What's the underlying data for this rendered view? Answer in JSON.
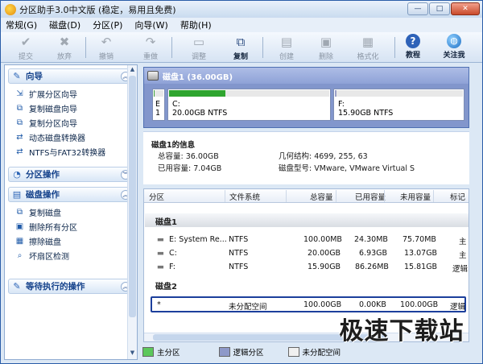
{
  "window": {
    "title": "分区助手3.0中文版 (稳定，易用且免费)",
    "buttons": {
      "minimize": "—",
      "maximize": "□",
      "close": "✕"
    }
  },
  "menu": [
    "常规(G)",
    "磁盘(D)",
    "分区(P)",
    "向导(W)",
    "帮助(H)"
  ],
  "toolbar": [
    {
      "label": "提交",
      "icon": "check-icon",
      "enabled": false
    },
    {
      "label": "放弃",
      "icon": "x-icon",
      "enabled": false
    },
    {
      "label": "撤销",
      "icon": "undo-icon",
      "enabled": false
    },
    {
      "label": "重做",
      "icon": "redo-icon",
      "enabled": false
    },
    {
      "label": "调整",
      "icon": "resize-icon",
      "enabled": false
    },
    {
      "label": "复制",
      "icon": "copy-disk-icon",
      "enabled": true
    },
    {
      "label": "创建",
      "icon": "create-icon",
      "enabled": false
    },
    {
      "label": "删除",
      "icon": "delete-icon",
      "enabled": false
    },
    {
      "label": "格式化",
      "icon": "format-icon",
      "enabled": false
    },
    {
      "label": "教程",
      "icon": "help-icon",
      "enabled": true
    },
    {
      "label": "关注我",
      "icon": "globe-icon",
      "enabled": true
    }
  ],
  "sidebar": {
    "wizard": {
      "title": "向导",
      "items": [
        "扩展分区向导",
        "复制磁盘向导",
        "复制分区向导",
        "动态磁盘转换器",
        "NTFS与FAT32转换器"
      ]
    },
    "partition_ops": {
      "title": "分区操作"
    },
    "disk_ops": {
      "title": "磁盘操作",
      "items": [
        "复制磁盘",
        "删除所有分区",
        "擦除磁盘",
        "坏扇区检测"
      ]
    },
    "pending": {
      "title": "等待执行的操作"
    }
  },
  "disk_map": {
    "title": "磁盘1 (36.00GB)",
    "partitions": [
      {
        "letter": "E",
        "sub": "1",
        "used_fraction": 0.1,
        "color": "#3da33d"
      },
      {
        "letter": "C:",
        "sub": "20.00GB NTFS",
        "used_fraction": 0.35,
        "color": "#2fa52f"
      },
      {
        "letter": "F:",
        "sub": "15.90GB NTFS",
        "used_fraction": 0.01,
        "color": "#9aa0c8"
      }
    ]
  },
  "disk_info": {
    "heading": "磁盘1的信息",
    "total_label": "总容量: 36.00GB",
    "free_label": "已用容量: 7.04GB",
    "geometry_label": "几何结构: 4699, 255, 63",
    "model_label": "磁盘型号: VMware, VMware Virtual S"
  },
  "table": {
    "columns": [
      "分区",
      "文件系统",
      "总容量",
      "已用容量",
      "未用容量",
      "标记"
    ],
    "groups": [
      {
        "name": "磁盘1",
        "rows": [
          [
            "E:  System Re...",
            "NTFS",
            "100.00MB",
            "24.30MB",
            "75.70MB",
            "主"
          ],
          [
            "C:",
            "NTFS",
            "20.00GB",
            "6.93GB",
            "13.07GB",
            "主"
          ],
          [
            "F:",
            "NTFS",
            "15.90GB",
            "86.26MB",
            "15.81GB",
            "逻辑"
          ]
        ]
      },
      {
        "name": "磁盘2",
        "rows": [
          [
            "*",
            "未分配空间",
            "100.00GB",
            "0.00KB",
            "100.00GB",
            "逻辑"
          ]
        ]
      }
    ]
  },
  "legend": [
    {
      "label": "主分区",
      "color": "#5cc85c"
    },
    {
      "label": "逻辑分区",
      "color": "#8e99c9"
    },
    {
      "label": "未分配空间",
      "color": "#f0f0f0"
    }
  ],
  "watermark": "极速下载站"
}
